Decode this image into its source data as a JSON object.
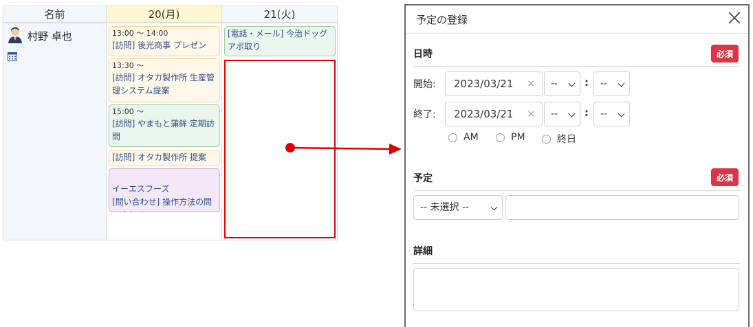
{
  "calendar": {
    "name_header": "名前",
    "day1_header": "20(月)",
    "day2_header": "21(火)",
    "user_name": "村野 卓也",
    "day1_events": [
      {
        "time": "13:00 ～ 14:00",
        "text": "[訪問] 後光商事 プレゼン",
        "color": "yellow"
      },
      {
        "time": "13:30 ～",
        "text": "[訪問] オタカ製作所 生産管理システム提案",
        "color": "yellow"
      },
      {
        "time": "15:00 ～",
        "text": "[訪問] やまもと蒲鉾 定期訪問",
        "color": "green"
      },
      {
        "time": "",
        "text": "[訪問] オタカ製作所 提案",
        "color": "yellow"
      },
      {
        "time": "",
        "text": "イーエスフーズ\n[問い合わせ] 操作方法の問い合わせ",
        "color": "purple"
      }
    ],
    "day2_events": [
      {
        "text": "[電話・メール] 今治ドッグ アポ取り",
        "color": "green"
      }
    ]
  },
  "colors": {
    "header_today": "#fdf7d0",
    "header_other": "#f2f7fc",
    "name_column": "#f2f7fc",
    "highlight_red": "#e00000",
    "required_badge": "#dc3545"
  },
  "modal": {
    "title": "予定の登録",
    "datetime_label": "日時",
    "required_badge": "必須",
    "start_label": "開始:",
    "end_label": "終了:",
    "start_date": "2023/03/21",
    "end_date": "2023/03/21",
    "hour_value": "--",
    "minute_value": "--",
    "time_colon": ":",
    "radios": [
      "AM",
      "PM",
      "終日"
    ],
    "schedule_label": "予定",
    "schedule_select": "-- 未選択 --",
    "details_label": "詳細",
    "clear_glyph": "×"
  }
}
